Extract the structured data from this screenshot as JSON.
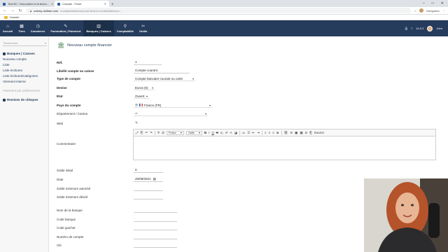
{
  "browser": {
    "tabs": [
      {
        "title": "TechSC, l'innovation et la techn...",
        "active": false
      },
      {
        "title": "Compte - Fiche",
        "active": true
      }
    ],
    "url_host": "udemy-dolibarr.com",
    "url_path": "/compta/bank/card.php?action=create&idmenu=...",
    "profile_label": "Navigation",
    "bookmark_folder": "Dossier"
  },
  "topmenu": {
    "items": [
      {
        "label": "Accueil",
        "icon": "⌂"
      },
      {
        "label": "Tiers",
        "icon": "▦"
      },
      {
        "label": "Commerce",
        "icon": "◷"
      },
      {
        "label": "Facturation | Paiement",
        "icon": "✎"
      },
      {
        "label": "Banques | Caisses",
        "icon": "▥"
      },
      {
        "label": "Comptabilité",
        "icon": "⚲"
      },
      {
        "label": "Outils",
        "icon": "✂"
      }
    ],
    "version": "14.0.2",
    "user": "John"
  },
  "sidebar": {
    "search_placeholder": "Rechercher",
    "section_title": "Banques | Caisses",
    "links": [
      "Nouveau compte",
      "Liste",
      "Liste écritures",
      "Liste écritures/catégories",
      "Virement interne"
    ],
    "muted": "Paiement par prélèvement",
    "section2_title": "Remises de chèques"
  },
  "page": {
    "title": "Nouveau compte financier"
  },
  "form": {
    "ref_label": "Réf.",
    "ref_value": "1",
    "libelle_label": "Libellé compte ou caisse",
    "libelle_value": "Compte courant",
    "type_label": "Type de compte",
    "type_value": "Compte bancaire courant ou carte",
    "devise_label": "Devise",
    "devise_value": "Euros (€)",
    "etat_label": "Etat",
    "etat_value": "Ouvert",
    "pays_label": "Pays du compte",
    "pays_value": "France (FR)",
    "departement_label": "Département / Canton",
    "web_label": "Web",
    "commentaire_label": "Commentaire",
    "solde_initial_label": "Solde initial",
    "solde_initial_value": "0",
    "date_label": "Date",
    "date_value": "25/09/2021",
    "solde_min_autorise_label": "Solde minimum autorisé",
    "solde_min_desire_label": "Solde minimum désiré",
    "nom_banque_label": "Nom de la banque",
    "code_banque_label": "Code banque",
    "code_guichet_label": "Code guichet",
    "numero_compte_label": "Numéro de compte",
    "cle_label": "Clé"
  },
  "editor": {
    "style_label": "Police",
    "size_label": "Taille",
    "source_label": "Source"
  }
}
